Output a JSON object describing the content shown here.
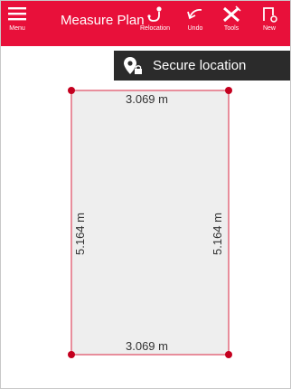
{
  "toolbar": {
    "menu_label": "Menu",
    "title": "Measure Plan",
    "relocation_label": "Relocation",
    "undo_label": "Undo",
    "tools_label": "Tools",
    "new_label": "New"
  },
  "banner": {
    "text": "Secure location"
  },
  "plan": {
    "top_length": "3.069 m",
    "bottom_length": "3.069 m",
    "left_length": "5.164 m",
    "right_length": "5.164 m"
  },
  "colors": {
    "accent": "#e8103a",
    "banner_bg": "#2b2b2b",
    "edge": "#e36b7e",
    "room_fill": "#eeeeee",
    "vertex": "#c4001f"
  }
}
